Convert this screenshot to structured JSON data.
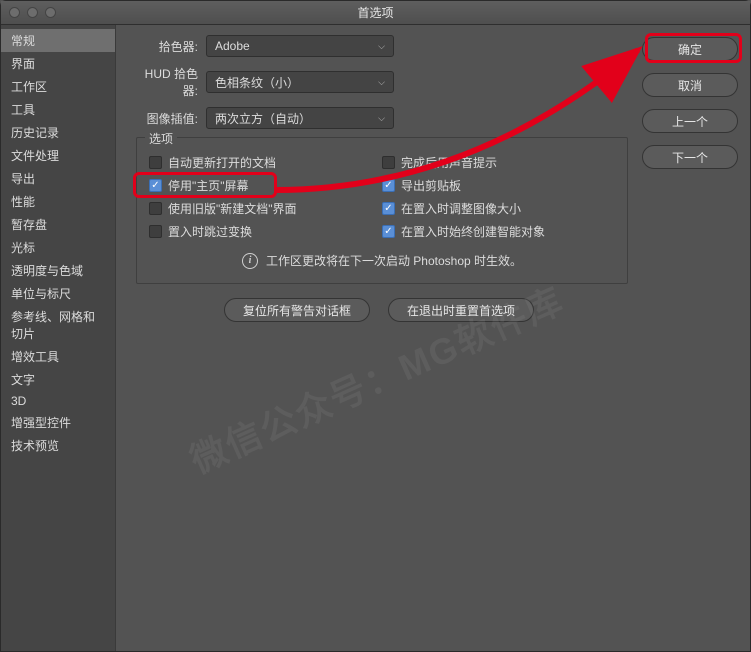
{
  "title": "首选项",
  "sidebar": {
    "items": [
      {
        "label": "常规"
      },
      {
        "label": "界面"
      },
      {
        "label": "工作区"
      },
      {
        "label": "工具"
      },
      {
        "label": "历史记录"
      },
      {
        "label": "文件处理"
      },
      {
        "label": "导出"
      },
      {
        "label": "性能"
      },
      {
        "label": "暂存盘"
      },
      {
        "label": "光标"
      },
      {
        "label": "透明度与色域"
      },
      {
        "label": "单位与标尺"
      },
      {
        "label": "参考线、网格和切片"
      },
      {
        "label": "增效工具"
      },
      {
        "label": "文字"
      },
      {
        "label": "3D"
      },
      {
        "label": "增强型控件"
      },
      {
        "label": "技术预览"
      }
    ],
    "active_index": 0
  },
  "fields": {
    "picker_label": "拾色器:",
    "picker_value": "Adobe",
    "hud_label": "HUD 拾色器:",
    "hud_value": "色相条纹（小）",
    "interp_label": "图像插值:",
    "interp_value": "两次立方（自动）"
  },
  "options": {
    "legend": "选项",
    "left": [
      {
        "label": "自动更新打开的文档",
        "checked": false
      },
      {
        "label": "停用\"主页\"屏幕",
        "checked": true
      },
      {
        "label": "使用旧版\"新建文档\"界面",
        "checked": false
      },
      {
        "label": "置入时跳过变换",
        "checked": false
      }
    ],
    "right": [
      {
        "label": "完成后用声音提示",
        "checked": false
      },
      {
        "label": "导出剪贴板",
        "checked": true
      },
      {
        "label": "在置入时调整图像大小",
        "checked": true
      },
      {
        "label": "在置入时始终创建智能对象",
        "checked": true
      }
    ],
    "note": "工作区更改将在下一次启动 Photoshop 时生效。"
  },
  "buttons": {
    "reset_warnings": "复位所有警告对话框",
    "reset_on_quit": "在退出时重置首选项",
    "ok": "确定",
    "cancel": "取消",
    "prev": "上一个",
    "next": "下一个"
  },
  "watermark": "微信公众号：MG软件库"
}
